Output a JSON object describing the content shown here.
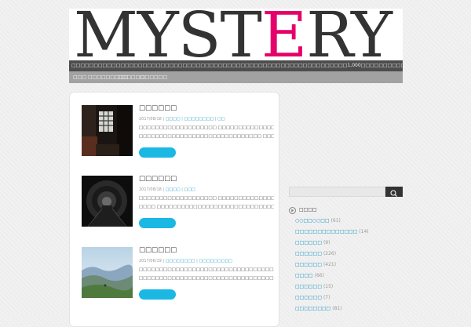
{
  "site": {
    "logo_prefix": "MYST",
    "logo_accent": "E",
    "logo_suffix": "RY",
    "accent_color": "#e5006a",
    "tagline": "□□□□□□□□□□□□□□□□□□□□□□□□□□□□□□□□□□□□□□□□□□□□□□□□□□□□□□□□□□□□□□1,000□□□□□□□□□□□"
  },
  "nav": {
    "items": [
      {
        "label": "□□□"
      },
      {
        "label": "□□□□□□□□□"
      },
      {
        "label": "□□□□□□"
      },
      {
        "label": "□□□□□□"
      }
    ]
  },
  "posts": [
    {
      "title": "□□□□□□",
      "date": "2017/08/18",
      "categories": [
        "□□□□",
        "□□□□□□□□",
        "□□"
      ],
      "excerpt": [
        "□□□□□□□□□□□□□□□□□□□ □□□□□□□□□□□□□□□□□□□□□□□□□□□□□□□□",
        "□□□□□□□□□□□□□□□□□□□□□□□□□□□□□□ □□□□□□..."
      ]
    },
    {
      "title": "□□□□□□",
      "date": "2017/08/18",
      "categories": [
        "□□□□",
        "□□□"
      ],
      "excerpt": [
        "□□□□□□□□□□□□□□□□□□□ □□□□□□□□□□□□□□□□□□□□□□□□□□□□□□□□",
        "□□□□ □□□□□□□□□□□□□□□□□□□□□□□□□□□□□□□□□□□..."
      ]
    },
    {
      "title": "□□□□□□",
      "date": "2017/06/19",
      "categories": [
        "□□□□□□□□",
        "□□□□□□□□□"
      ],
      "excerpt": [
        "□□□□□□□□□□□□□□□□□□□□□□□□□□□□□□□□□□□□□□□□□□□□□□□□□□□",
        "□□□□□□□□□□□□□□□□□□□□□□□□□□□□□□□□□□□□□□□□□..."
      ]
    }
  ],
  "sidebar": {
    "widget_title": "□□□□",
    "categories": [
      {
        "name": "○○□□○○□□",
        "count": "(61)"
      },
      {
        "name": "□□□□□□□□□□□□□□",
        "count": "(14)"
      },
      {
        "name": "□□□□□□",
        "count": "(9)"
      },
      {
        "name": "□□□□□□",
        "count": "(226)"
      },
      {
        "name": "□□□□□□",
        "count": "(421)"
      },
      {
        "name": "□□□□",
        "count": "(66)"
      },
      {
        "name": "□□□□□□",
        "count": "(15)"
      },
      {
        "name": "□□□□□□",
        "count": "(7)"
      },
      {
        "name": "□□□□□□□□",
        "count": "(81)"
      }
    ]
  }
}
